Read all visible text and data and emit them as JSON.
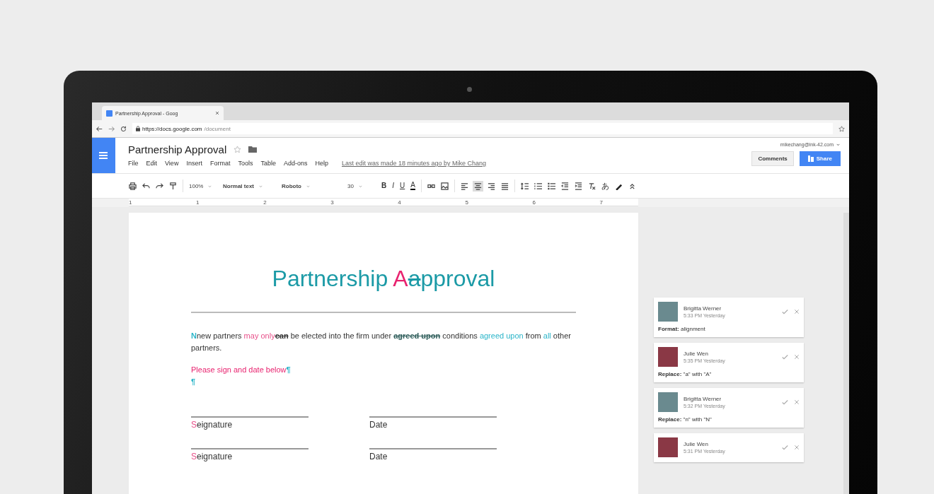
{
  "browser": {
    "tab_title": "Partnership Approval - Goog",
    "url_host": "https://docs.google.com",
    "url_path": "/document"
  },
  "docs": {
    "title": "Partnership Approval",
    "menu": [
      "File",
      "Edit",
      "View",
      "Insert",
      "Format",
      "Tools",
      "Table",
      "Add-ons",
      "Help"
    ],
    "last_edit": "Last edit was made 18 minutes ago by Mike Chang",
    "account": "mikechang@ink-42.com",
    "comments_button": "Comments",
    "share_button": "Share"
  },
  "toolbar": {
    "zoom": "100%",
    "style": "Normal text",
    "font": "Roboto",
    "size": "30",
    "format_buttons": [
      {
        "kind": "bold",
        "label": "B"
      },
      {
        "kind": "italic",
        "label": "I"
      },
      {
        "kind": "underline",
        "label": "U"
      },
      {
        "kind": "color",
        "label": "A"
      }
    ],
    "input_tools": "あ"
  },
  "ruler": [
    "1",
    "1",
    "2",
    "3",
    "4",
    "5",
    "6",
    "7"
  ],
  "document": {
    "title": [
      {
        "text": "Partnership ",
        "color": "#1b9aa6",
        "struck": false,
        "bold": false
      },
      {
        "text": "A",
        "color": "#e8236f",
        "struck": false,
        "bold": false
      },
      {
        "text": "a",
        "color": "#1b9aa6",
        "struck": true,
        "bold": false
      },
      {
        "text": "pproval",
        "color": "#1b9aa6",
        "struck": false,
        "bold": false
      }
    ],
    "paragraphs": [
      [
        {
          "text": "N",
          "color": "#2bb5c9",
          "struck": false,
          "bold": true
        },
        {
          "text": "new partners ",
          "color": "#333333",
          "struck": false,
          "bold": false
        },
        {
          "text": "may only",
          "color": "#e8508a",
          "struck": false,
          "bold": false
        },
        {
          "text": "can",
          "color": "#333333",
          "struck": true,
          "bold": true
        },
        {
          "text": " be elected into the firm under ",
          "color": "#333333",
          "struck": false,
          "bold": false
        },
        {
          "text": "agreed upon",
          "color": "#2e5d5a",
          "struck": true,
          "bold": true
        },
        {
          "text": " conditions ",
          "color": "#333333",
          "struck": false,
          "bold": false
        },
        {
          "text": "agreed upon",
          "color": "#2bb5c9",
          "struck": false,
          "bold": false
        },
        {
          "text": " from ",
          "color": "#333333",
          "struck": false,
          "bold": false
        },
        {
          "text": "all",
          "color": "#2bb5c9",
          "struck": false,
          "bold": false
        },
        {
          "text": " other partners.",
          "color": "#333333",
          "struck": false,
          "bold": false
        }
      ],
      [
        {
          "text": "Please sign and date below",
          "color": "#e8236f",
          "struck": false,
          "bold": false
        },
        {
          "text": "¶",
          "color": "#2bb5c9",
          "struck": false,
          "bold": true
        }
      ],
      [
        {
          "text": "¶",
          "color": "#2bb5c9",
          "struck": false,
          "bold": true
        }
      ]
    ],
    "signature_rows": [
      [
        [
          {
            "text": "S",
            "color": "#e8508a",
            "struck": false,
            "bold": false
          },
          {
            "text": "eignature",
            "color": "#333333",
            "struck": false,
            "bold": false
          }
        ],
        [
          {
            "text": "Date",
            "color": "#333333",
            "struck": false,
            "bold": false
          }
        ]
      ],
      [
        [
          {
            "text": "S",
            "color": "#e8508a",
            "struck": false,
            "bold": false
          },
          {
            "text": "eignature",
            "color": "#333333",
            "struck": false,
            "bold": false
          }
        ],
        [
          {
            "text": "Date",
            "color": "#333333",
            "struck": false,
            "bold": false
          }
        ]
      ]
    ]
  },
  "comments": [
    {
      "name": "Brigitta Werner",
      "time": "5:33 PM Yesterday",
      "body": "**Format:** alignment"
    },
    {
      "name": "Julie Wen",
      "time": "5:35 PM Yesterday",
      "body": "**Replace:** \"a\" with \"A\""
    },
    {
      "name": "Brigitta Werner",
      "time": "5:32 PM Yesterday",
      "body": "**Replace:** \"n\" with \"N\""
    },
    {
      "name": "Julie Wen",
      "time": "5:31 PM Yesterday"
    }
  ]
}
